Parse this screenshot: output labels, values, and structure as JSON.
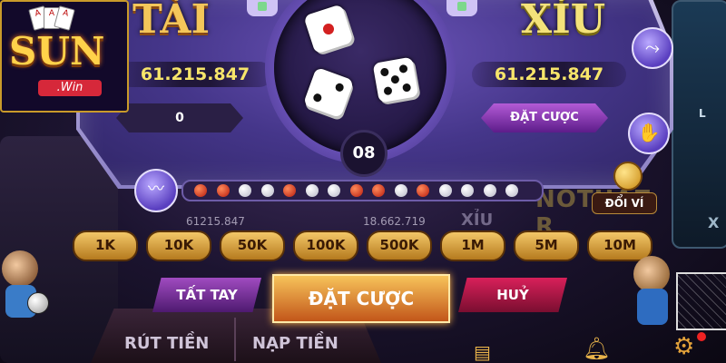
{
  "logo": {
    "brand": "SUN",
    "suffix": ".Win",
    "cards": [
      "A",
      "A",
      "A"
    ]
  },
  "table": {
    "tai_label": "TÀI",
    "xiu_label": "XỈU",
    "tai_total": "61.215.847",
    "xiu_total": "61.215.847",
    "bet_amount": "0",
    "bet_button_label": "ĐẶT CƯỢC",
    "timer": "08",
    "dice": [
      1,
      2,
      5
    ],
    "history": [
      "t",
      "t",
      "x",
      "x",
      "t",
      "x",
      "x",
      "t",
      "t",
      "x",
      "t",
      "x",
      "x",
      "x",
      "x"
    ]
  },
  "background": {
    "stat_left": "61215.847",
    "stat_right": "18.662.719",
    "banner_text": "NOTHAZ R",
    "xiu_faint": "XỈU"
  },
  "wallet": {
    "label": "ĐỔI VÍ"
  },
  "chips": [
    "1K",
    "10K",
    "50K",
    "100K",
    "500K",
    "1M",
    "5M",
    "10M"
  ],
  "actions": {
    "all_in": "TẤT TAY",
    "place_bet": "ĐẶT CƯỢC",
    "cancel": "HUỶ"
  },
  "footer": {
    "withdraw": "RÚT TIỀN",
    "deposit": "NẠP TIỀN"
  },
  "icons": {
    "left_side_icon": "history-chart-icon",
    "right_top": "chart-zigzag-icon",
    "right_mid": "hand-icon",
    "wallet": "coin-icon",
    "gear": "gear-icon",
    "bell": "bell-icon",
    "slip": "receipt-icon"
  },
  "colors": {
    "gold": "#f4c65a",
    "purple": "#6b54b8",
    "cancel_red": "#d8205a"
  }
}
